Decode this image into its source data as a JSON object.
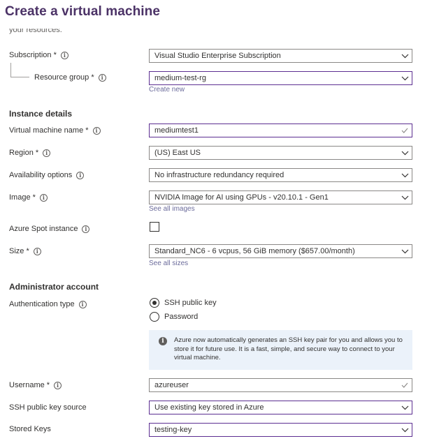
{
  "title": "Create a virtual machine",
  "cut_text": "your resources.",
  "subscription": {
    "label": "Subscription *",
    "value": "Visual Studio Enterprise Subscription"
  },
  "resource_group": {
    "label": "Resource group *",
    "value": "medium-test-rg",
    "create_new": "Create new"
  },
  "instance_details": {
    "heading": "Instance details",
    "vm_name": {
      "label": "Virtual machine name *",
      "value": "mediumtest1"
    },
    "region": {
      "label": "Region *",
      "value": "(US) East US"
    },
    "availability": {
      "label": "Availability options",
      "value": "No infrastructure redundancy required"
    },
    "image": {
      "label": "Image *",
      "value": "NVIDIA Image for AI using GPUs - v20.10.1 - Gen1",
      "see_all": "See all images"
    },
    "spot": {
      "label": "Azure Spot instance",
      "checked": false
    },
    "size": {
      "label": "Size *",
      "value": "Standard_NC6 - 6 vcpus, 56 GiB memory ($657.00/month)",
      "see_all": "See all sizes"
    }
  },
  "admin": {
    "heading": "Administrator account",
    "auth": {
      "label": "Authentication type",
      "options": [
        "SSH public key",
        "Password"
      ],
      "selected": "SSH public key",
      "info": "Azure now automatically generates an SSH key pair for you and allows you to store it for future use. It is a fast, simple, and secure way to connect to your virtual machine."
    },
    "username": {
      "label": "Username *",
      "value": "azureuser"
    },
    "ssh_source": {
      "label": "SSH public key source",
      "value": "Use existing key stored in Azure"
    },
    "stored_keys": {
      "label": "Stored Keys",
      "value": "testing-key"
    }
  },
  "colors": {
    "title": "#4b3266",
    "focus_border": "#5c2e91",
    "link": "#6b6b9b",
    "info_bg": "#ebf2fa",
    "check": "#57a300"
  },
  "icons": {
    "info": "info-icon",
    "dropdown": "chevron-down-icon",
    "valid": "checkmark-icon"
  }
}
